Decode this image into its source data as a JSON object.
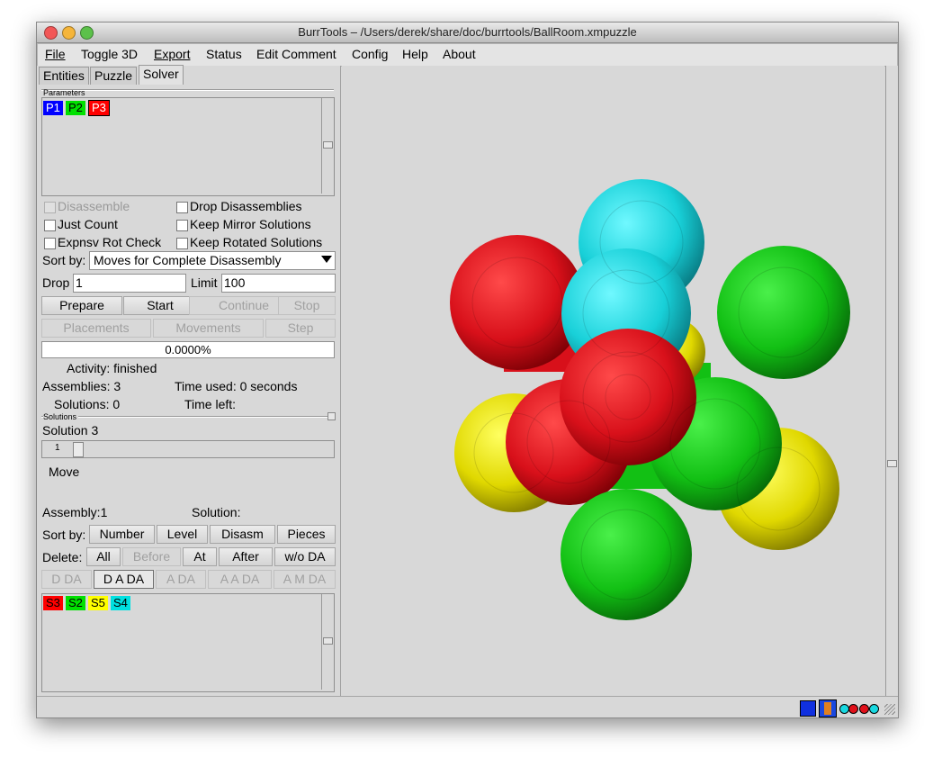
{
  "window": {
    "title": "BurrTools – /Users/derek/share/doc/burrtools/BallRoom.xmpuzzle"
  },
  "menu": {
    "file": "File",
    "toggle3d": "Toggle 3D",
    "export": "Export",
    "status": "Status",
    "edit_comment": "Edit Comment",
    "config": "Config",
    "help": "Help",
    "about": "About"
  },
  "tabs": {
    "entities": "Entities",
    "puzzle": "Puzzle",
    "solver": "Solver"
  },
  "parameters": {
    "group_label": "Parameters",
    "problems": [
      {
        "label": "P1",
        "color": "#0000ff",
        "text": "#ffffff"
      },
      {
        "label": "P2",
        "color": "#00e000",
        "text": "#000000"
      },
      {
        "label": "P3",
        "color": "#ff0000",
        "text": "#ffffff"
      }
    ]
  },
  "options": {
    "disassemble": "Disassemble",
    "drop_disassemblies": "Drop Disassemblies",
    "just_count": "Just Count",
    "keep_mirror": "Keep Mirror Solutions",
    "expnsv_rot_check": "Expnsv Rot Check",
    "keep_rotated": "Keep Rotated Solutions"
  },
  "sort": {
    "label": "Sort by:",
    "value": "Moves for Complete Disassembly"
  },
  "drop": {
    "label": "Drop",
    "value": "1"
  },
  "limit": {
    "label": "Limit",
    "value": "100"
  },
  "buttons": {
    "prepare": "Prepare",
    "start": "Start",
    "continue": "Continue",
    "stop": "Stop",
    "placements": "Placements",
    "movements": "Movements",
    "step": "Step"
  },
  "progress": {
    "text": "0.0000%",
    "fraction": 0
  },
  "status": {
    "activity": "Activity: finished",
    "assemblies": "Assemblies: 3",
    "time_used": "Time used: 0 seconds",
    "solutions": "Solutions: 0",
    "time_left": "Time left:"
  },
  "solutions": {
    "group_label": "Solutions",
    "title": "Solution 3",
    "slider_value": "1",
    "move_label": "Move",
    "assembly": "Assembly:1",
    "solution": "Solution:",
    "sort_label": "Sort by:",
    "sort_number": "Number",
    "sort_level": "Level",
    "sort_disasm": "Disasm",
    "sort_pieces": "Pieces",
    "delete_label": "Delete:",
    "del_all": "All",
    "del_before": "Before",
    "del_at": "At",
    "del_after": "After",
    "del_wo_da": "w/o DA",
    "d_da": "D DA",
    "d_a_da": "D A DA",
    "a_da": "A DA",
    "a_a_da": "A A DA",
    "a_m_da": "A M DA",
    "pieces": [
      {
        "label": "S3",
        "color": "#ff0000"
      },
      {
        "label": "S2",
        "color": "#00e000"
      },
      {
        "label": "S5",
        "color": "#ffff00"
      },
      {
        "label": "S4",
        "color": "#00e0e0"
      }
    ]
  },
  "colors": {
    "red": "#e0101a",
    "green": "#12c814",
    "yellow": "#e8e000",
    "cyan": "#18d8e0"
  }
}
